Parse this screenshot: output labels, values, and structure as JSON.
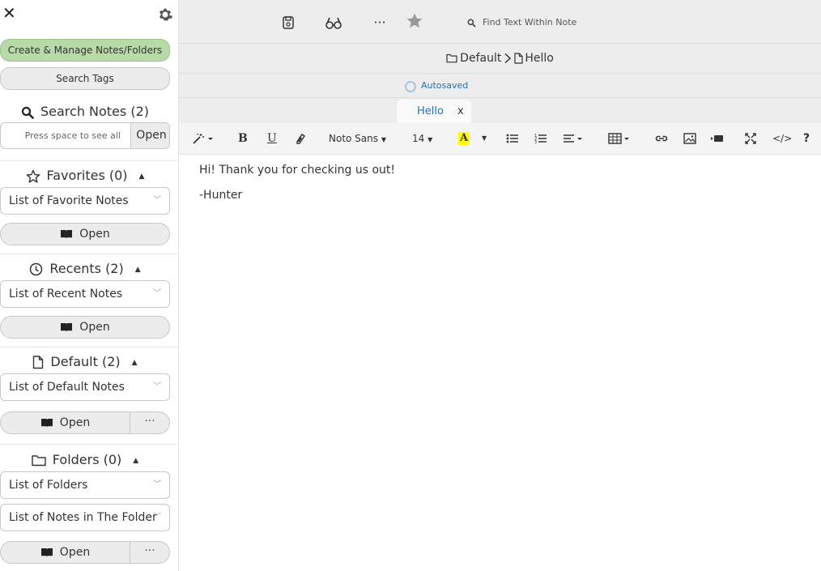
{
  "sidebar": {
    "create_manage_label": "Create & Manage Notes/Folders",
    "search_tags_label": "Search Tags",
    "search_notes": {
      "title": "Search Notes (2)",
      "placeholder": "Press space to see all",
      "open_label": "Open"
    },
    "favorites": {
      "title": "Favorites (0)",
      "select_value": "List of Favorite Notes",
      "open_label": "Open"
    },
    "recents": {
      "title": "Recents (2)",
      "select_value": "List of Recent Notes",
      "open_label": "Open"
    },
    "default": {
      "title": "Default (2)",
      "select_value": "List of Default Notes",
      "open_label": "Open",
      "more_label": "···"
    },
    "folders": {
      "title": "Folders (0)",
      "select_value": "List of Folders",
      "notes_select_value": "List of Notes in The Folder",
      "open_label": "Open",
      "more_label": "···"
    }
  },
  "topbar": {
    "more_label": "···",
    "find_placeholder": "Find Text Within Note"
  },
  "path": {
    "folder": "Default",
    "note": "Hello"
  },
  "status": {
    "autosaved": "Autosaved"
  },
  "tabs": [
    {
      "label": "Hello",
      "close": "x"
    }
  ],
  "toolbar": {
    "font_family": "Noto Sans",
    "font_size": "14",
    "code_label": "</>",
    "help_label": "?",
    "bold_label": "B",
    "underline_label": "U",
    "highlight_label": "A"
  },
  "note": {
    "lines": [
      "Hi! Thank you for checking us out!",
      "-Hunter"
    ]
  },
  "colors": {
    "accent_blue": "#2a6db0",
    "create_button_green": "#b8d9a8",
    "highlight_yellow": "#ffff00"
  }
}
